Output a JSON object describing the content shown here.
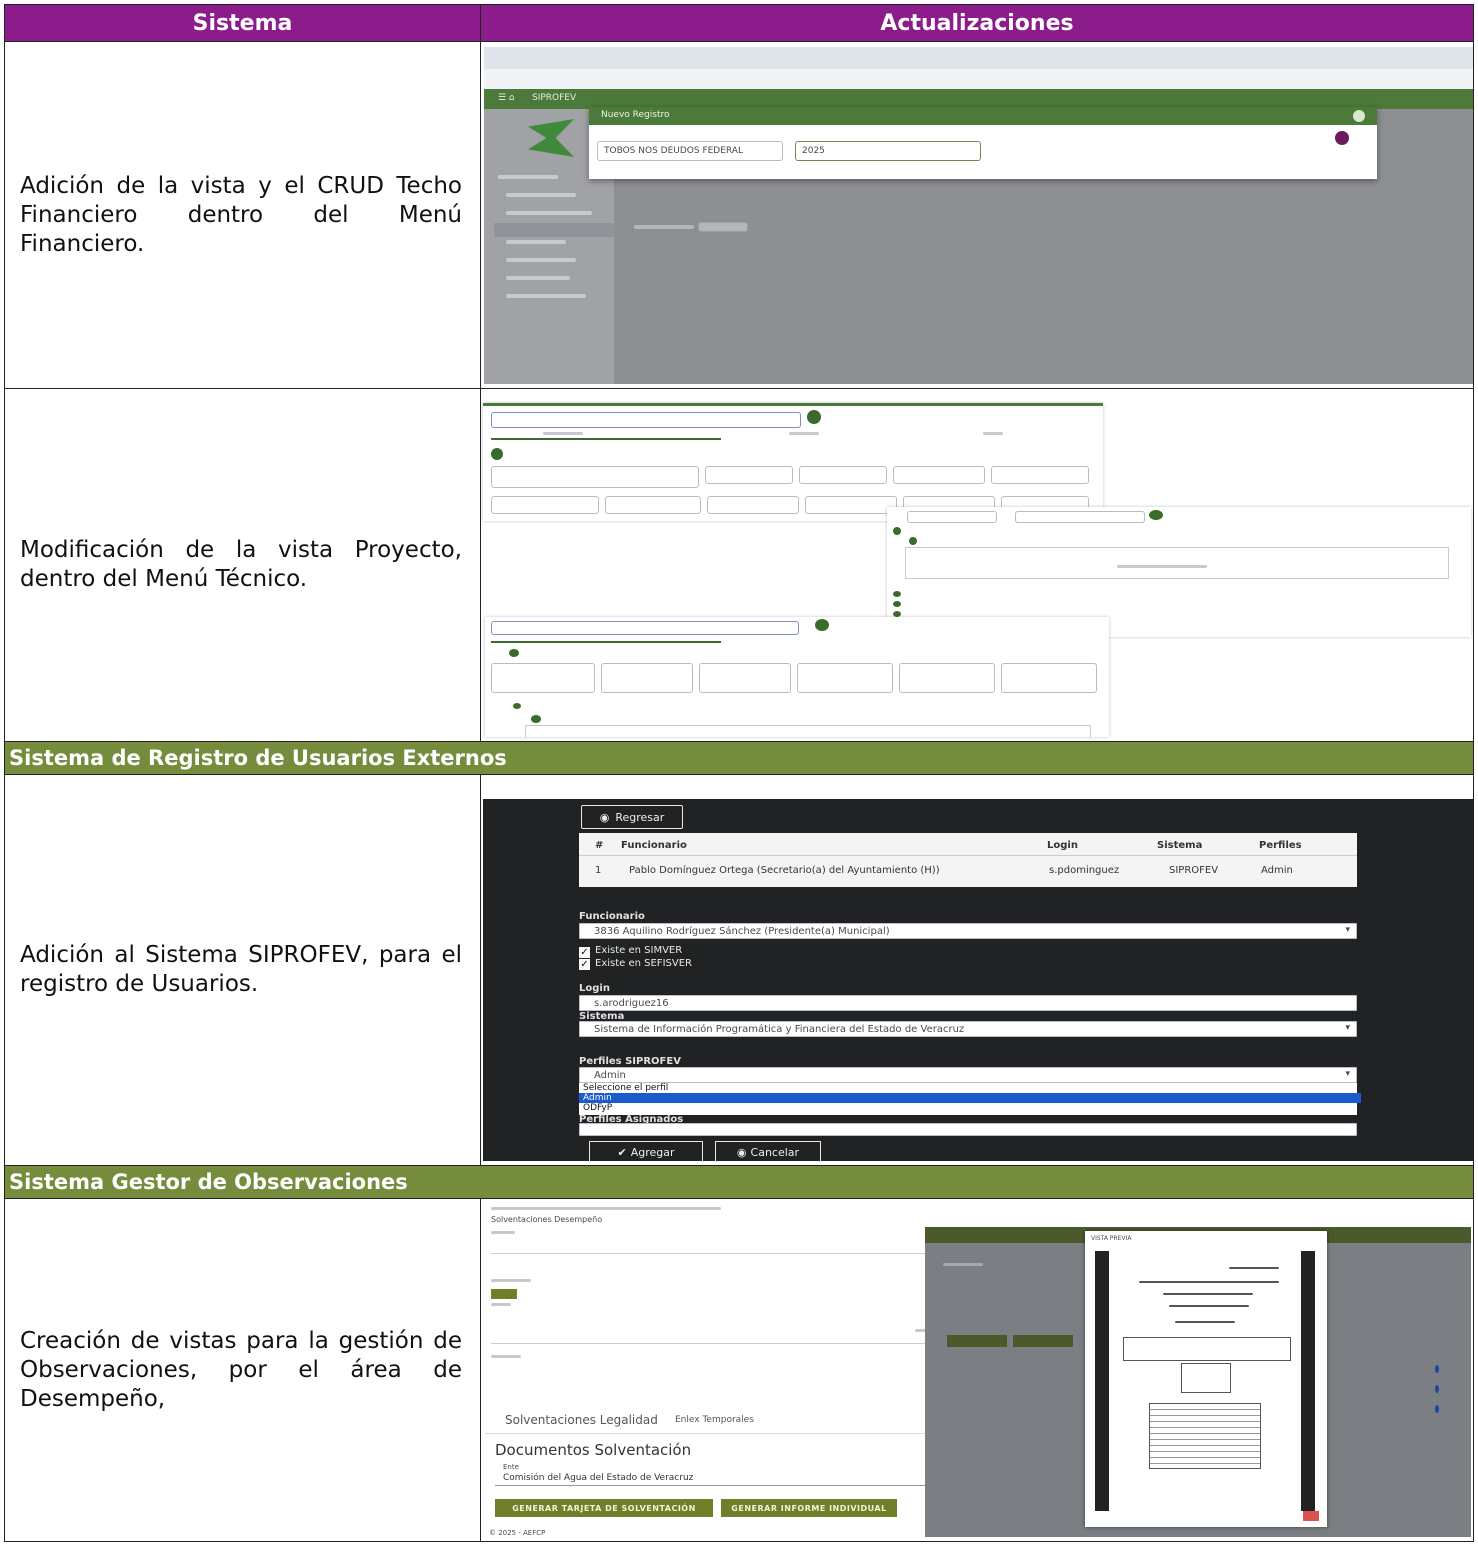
{
  "table": {
    "header_system": "Sistema",
    "header_updates": "Actualizaciones"
  },
  "rows": [
    {
      "description": "Adición de la vista y el CRUD Techo Financiero dentro del Menú Financiero."
    },
    {
      "description": "Modificación de la vista Proyecto, dentro del Menú Técnico."
    },
    {
      "description": "Adición al Sistema SIPROFEV, para el registro de Usuarios."
    },
    {
      "description": "Creación de vistas para la gestión de Observaciones, por el área de Desempeño,"
    }
  ],
  "sections": {
    "usuarios_externos": "Sistema de Registro de Usuarios Externos",
    "gestor_observaciones": "Sistema Gestor de Observaciones"
  },
  "shot1": {
    "app_name": "SIPROFEV",
    "modal_title": "Nuevo Registro",
    "select_ente": "TOBOS NOS DEUDOS FEDERAL",
    "select_year": "2025"
  },
  "shot3": {
    "btn_regresar": "Regresar",
    "col_num": "#",
    "col_funcionario": "Funcionario",
    "col_login": "Login",
    "col_sistema": "Sistema",
    "col_perfiles": "Perfiles",
    "row_num": "1",
    "row_funcionario": "Pablo Domínguez Ortega (Secretario(a) del Ayuntamiento (H))",
    "row_login": "s.pdominguez",
    "row_sistema": "SIPROFEV",
    "row_perfil": "Admin",
    "lbl_funcionario": "Funcionario",
    "val_funcionario": "3836 Aquilino Rodríguez Sánchez (Presidente(a) Municipal)",
    "chk_simver": "Existe en SIMVER",
    "chk_sefisver": "Existe en SEFISVER",
    "lbl_login": "Login",
    "val_login": "s.arodriguez16",
    "lbl_sistema": "Sistema",
    "val_sistema": "Sistema de Información Programática y Financiera del Estado de Veracruz",
    "lbl_perfiles": "Perfiles SIPROFEV",
    "val_perfil": "Admin",
    "opt_placeholder": "Seleccione el perfil",
    "opt_admin": "Admin",
    "opt_odfyp": "ODFyP",
    "lbl_asignados": "Perfiles Asignados",
    "btn_agregar": "Agregar",
    "btn_cancelar": "Cancelar"
  },
  "shot4": {
    "tab_legalidad": "Solventaciones Legalidad",
    "tab_enlace": "Enlex Temporales",
    "doc_title": "Documentos Solventación",
    "ente_label": "Ente",
    "ente_value": "Comisión del Agua del Estado de Veracruz",
    "btn_tarjeta": "GENERAR TARJETA DE SOLVENTACIÓN",
    "btn_informe": "GENERAR INFORME INDIVIDUAL",
    "footer": "© 2025 - AEFCP",
    "top_title": "Solventaciones Desempeño",
    "modal_title": "VISTA PREVIA"
  },
  "colors": {
    "header_purple": "#8c1b8c",
    "section_green": "#748c3c",
    "app_green": "#4c7a3a"
  }
}
